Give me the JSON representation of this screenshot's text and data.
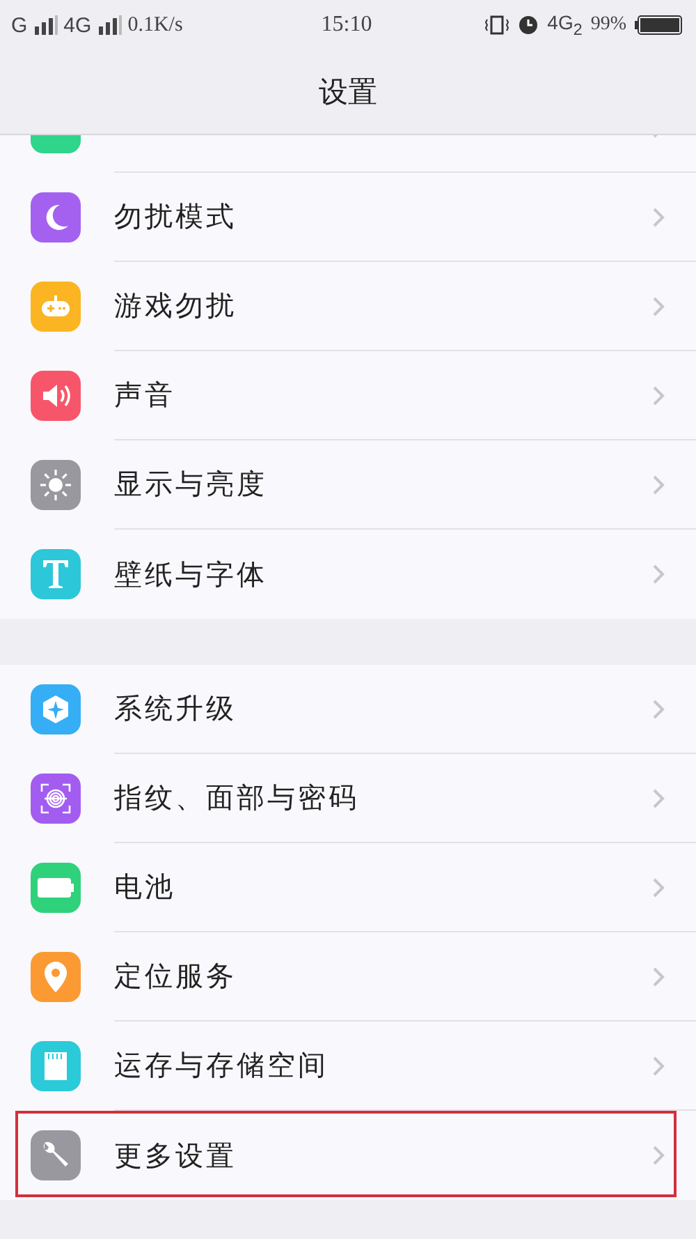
{
  "status_bar": {
    "network_1": "G",
    "network_2": "4G",
    "speed": "0.1K/s",
    "time": "15:10",
    "network_3": "4G$_{2}$",
    "battery": "99%"
  },
  "header": {
    "title": "设置"
  },
  "groups": [
    {
      "partial_top": {
        "color": "#2fd58a"
      },
      "items": [
        {
          "label": "勿扰模式",
          "kind": "moon",
          "color": "#a461f0",
          "highlighted": false
        },
        {
          "label": "游戏勿扰",
          "kind": "gamepad",
          "color": "#fbb523",
          "highlighted": false
        },
        {
          "label": "声音",
          "kind": "speaker",
          "color": "#f7566a",
          "highlighted": false
        },
        {
          "label": "显示与亮度",
          "kind": "sun",
          "color": "#98989e",
          "highlighted": false
        },
        {
          "label": "壁纸与字体",
          "kind": "letter",
          "color": "#2cc7d8",
          "highlighted": false
        }
      ]
    },
    {
      "items": [
        {
          "label": "系统升级",
          "kind": "update",
          "color": "#35aef5",
          "highlighted": false
        },
        {
          "label": "指纹、面部与密码",
          "kind": "fingerprint",
          "color": "#a35cf0",
          "highlighted": false
        },
        {
          "label": "电池",
          "kind": "battery",
          "color": "#2fd27b",
          "highlighted": false
        },
        {
          "label": "定位服务",
          "kind": "pin",
          "color": "#fb9a33",
          "highlighted": false
        },
        {
          "label": "运存与存储空间",
          "kind": "card",
          "color": "#2bcad9",
          "highlighted": false
        },
        {
          "label": "更多设置",
          "kind": "wrench",
          "color": "#98989e",
          "highlighted": true
        }
      ]
    }
  ]
}
